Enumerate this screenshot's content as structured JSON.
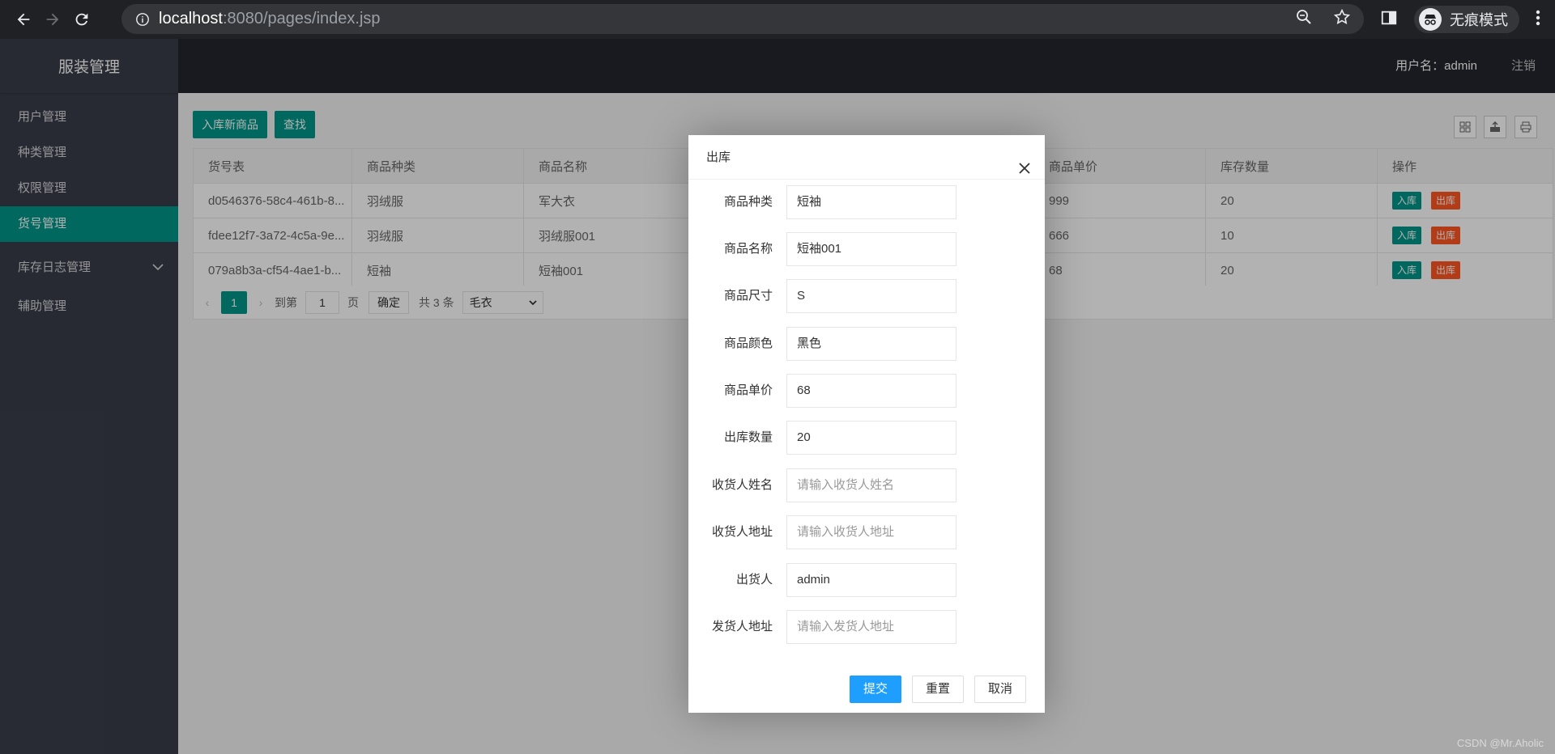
{
  "browser": {
    "url_host": "localhost",
    "url_rest": ":8080/pages/index.jsp",
    "incognito_label": "无痕模式"
  },
  "app": {
    "logo": "服装管理",
    "user_label": "用户名：admin",
    "logout": "注销"
  },
  "sidebar": {
    "items": [
      {
        "label": "用户管理"
      },
      {
        "label": "种类管理"
      },
      {
        "label": "权限管理"
      },
      {
        "label": "货号管理"
      },
      {
        "label": "库存日志管理"
      },
      {
        "label": "辅助管理"
      }
    ]
  },
  "toolbar": {
    "add_label": "入库新商品",
    "search_label": "查找"
  },
  "table": {
    "headers": [
      "货号表",
      "商品种类",
      "商品名称",
      "商品单价",
      "库存数量",
      "操作"
    ],
    "rows": [
      {
        "id": "d0546376-58c4-461b-8...",
        "category": "羽绒服",
        "name": "军大衣",
        "price": "999",
        "stock": "20"
      },
      {
        "id": "fdee12f7-3a72-4c5a-9e...",
        "category": "羽绒服",
        "name": "羽绒服001",
        "price": "666",
        "stock": "10"
      },
      {
        "id": "079a8b3a-cf54-4ae1-b...",
        "category": "短袖",
        "name": "短袖001",
        "price": "68",
        "stock": "20"
      }
    ],
    "in_label": "入库",
    "out_label": "出库"
  },
  "pager": {
    "current": "1",
    "goto_label": "到第",
    "page_input": "1",
    "page_unit": "页",
    "confirm": "确定",
    "total": "共 3 条",
    "select_value": "毛衣"
  },
  "dialog": {
    "title": "出库",
    "fields": [
      {
        "label": "商品种类",
        "value": "短袖",
        "placeholder": ""
      },
      {
        "label": "商品名称",
        "value": "短袖001",
        "placeholder": ""
      },
      {
        "label": "商品尺寸",
        "value": "S",
        "placeholder": ""
      },
      {
        "label": "商品颜色",
        "value": "黑色",
        "placeholder": ""
      },
      {
        "label": "商品单价",
        "value": "68",
        "placeholder": ""
      },
      {
        "label": "出库数量",
        "value": "20",
        "placeholder": ""
      },
      {
        "label": "收货人姓名",
        "value": "",
        "placeholder": "请输入收货人姓名"
      },
      {
        "label": "收货人地址",
        "value": "",
        "placeholder": "请输入收货人地址"
      },
      {
        "label": "出货人",
        "value": "admin",
        "placeholder": ""
      },
      {
        "label": "发货人地址",
        "value": "",
        "placeholder": "请输入发货人地址"
      }
    ],
    "submit": "提交",
    "reset": "重置",
    "cancel": "取消"
  },
  "watermark": "CSDN @Mr.Aholic",
  "colors": {
    "accent": "#009688",
    "danger": "#ff5722",
    "primary": "#1e9fff",
    "sidebar": "#393d49",
    "topbar": "#23262e"
  }
}
